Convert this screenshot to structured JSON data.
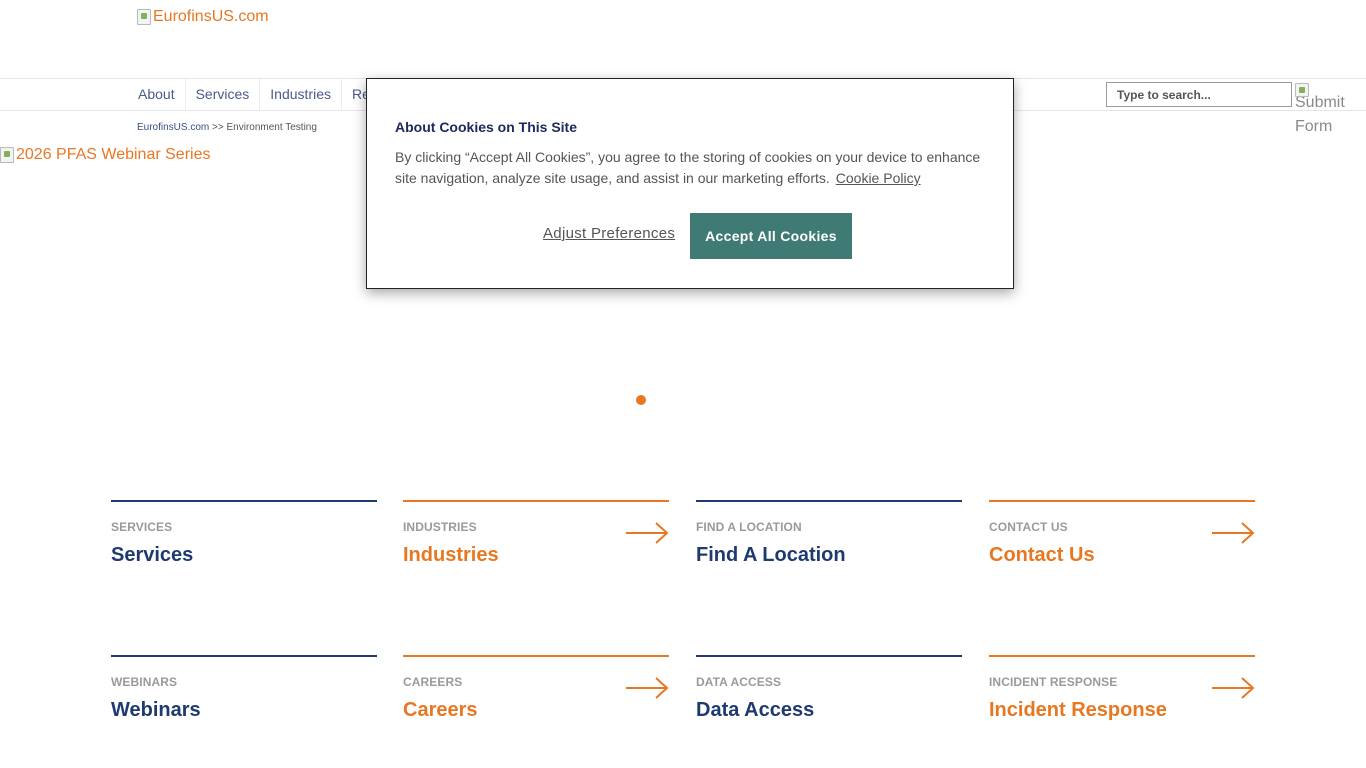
{
  "header": {
    "logo_alt": "EurofinsUS.com"
  },
  "nav": {
    "items": [
      {
        "label": "About"
      },
      {
        "label": "Services"
      },
      {
        "label": "Industries"
      },
      {
        "label": "Re"
      }
    ],
    "search": {
      "placeholder": "Type to search..."
    },
    "submit_alt": "Submit Form"
  },
  "breadcrumb": {
    "home": "EurofinsUS.com",
    "separator": " >> ",
    "current": "Environment Testing"
  },
  "hero": {
    "image_alt": "2026 PFAS Webinar Series"
  },
  "tiles": [
    {
      "eyebrow": "SERVICES",
      "title": "Services",
      "style": "navy",
      "arrow": false
    },
    {
      "eyebrow": "INDUSTRIES",
      "title": "Industries",
      "style": "orange",
      "arrow": true
    },
    {
      "eyebrow": "FIND A LOCATION",
      "title": "Find A Location",
      "style": "navy",
      "arrow": false
    },
    {
      "eyebrow": "CONTACT US",
      "title": "Contact Us",
      "style": "orange",
      "arrow": true
    },
    {
      "eyebrow": "WEBINARS",
      "title": "Webinars",
      "style": "navy",
      "arrow": false
    },
    {
      "eyebrow": "CAREERS",
      "title": "Careers",
      "style": "orange",
      "arrow": true
    },
    {
      "eyebrow": "DATA ACCESS",
      "title": "Data Access",
      "style": "navy",
      "arrow": false
    },
    {
      "eyebrow": "INCIDENT RESPONSE",
      "title": "Incident Response",
      "style": "orange",
      "arrow": true
    }
  ],
  "cookie_banner": {
    "title": "About Cookies on This Site",
    "body": "By clicking “Accept All Cookies”, you agree to the storing of cookies on your device to enhance site navigation, analyze site usage, and assist in our marketing efforts.",
    "policy_link": "Cookie Policy",
    "adjust_label": "Adjust Preferences",
    "accept_label": "Accept All Cookies"
  },
  "colors": {
    "navy": "#1f3a70",
    "orange": "#e87722",
    "accept_button": "#3f7a74"
  }
}
